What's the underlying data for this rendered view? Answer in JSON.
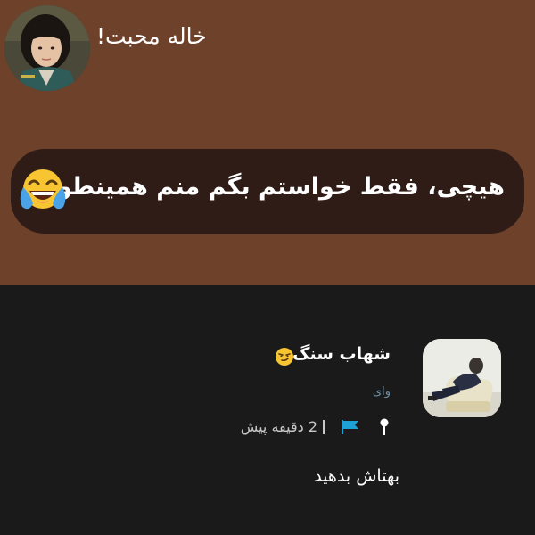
{
  "story": {
    "author": "خاله محبت!",
    "text": "هیچی، فقط خواستم بگم منم همینطور",
    "emoji": "tears-of-joy-emoji"
  },
  "comment": {
    "name": "شهاب سنگ",
    "name_emoji": "smirk-emoji",
    "handle": "وای",
    "time": "2 دقیقه پیش",
    "body": "بهتاش بدهید",
    "icons": [
      "pin-icon",
      "flag-icon"
    ]
  },
  "colors": {
    "story_bg": "#6e412a",
    "bubble_bg": "#2f1c17",
    "comment_bg": "#1a1a1a",
    "handle": "#6b8fa8",
    "flag": "#1da1d6"
  }
}
